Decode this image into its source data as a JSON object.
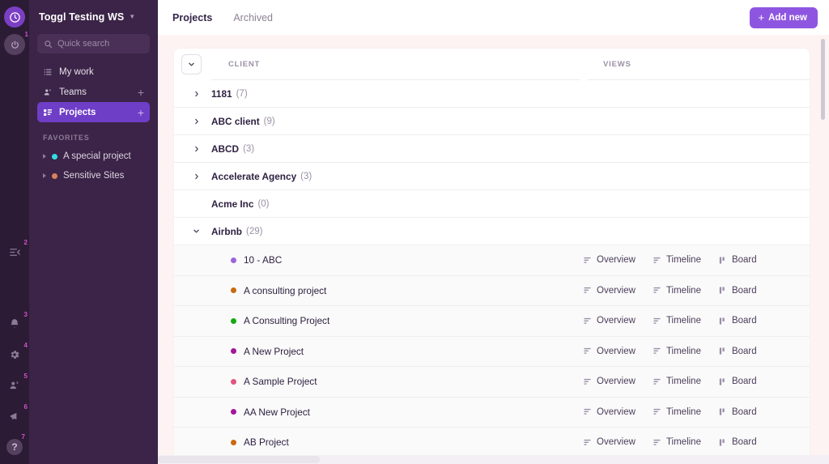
{
  "colors": {
    "rail_bg": "#2c1b35",
    "sidebar_bg": "#3b2447",
    "accent_purple": "#8e56e0",
    "active_nav": "#6f3ec7",
    "main_bg": "#fdf3f2",
    "card_bg": "#ffffff",
    "project_row_bg": "#fafafa",
    "badge_pink": "#d052c8"
  },
  "rail": {
    "logo_icon": "toggl-logo-icon",
    "timer_icon": "timer-power-icon",
    "timer_badge": "1",
    "items": [
      {
        "icon": "collapse-panel-icon",
        "badge": "2",
        "name": "collapse-sidebar-button"
      },
      {
        "icon": "bell-icon",
        "badge": "3",
        "name": "notifications-button"
      },
      {
        "icon": "gear-icon",
        "badge": "4",
        "name": "settings-button"
      },
      {
        "icon": "people-icon",
        "badge": "5",
        "name": "invite-team-button"
      },
      {
        "icon": "megaphone-icon",
        "badge": "6",
        "name": "whats-new-button"
      },
      {
        "icon": "question-mark-icon",
        "badge": "7",
        "name": "help-button"
      }
    ]
  },
  "sidebar": {
    "workspace_name": "Toggl Testing WS",
    "workspace_caret_icon": "chevron-down-icon",
    "search": {
      "placeholder": "Quick search",
      "icon": "search-icon"
    },
    "nav": [
      {
        "label": "My work",
        "icon": "list-icon",
        "active": false,
        "has_plus": false
      },
      {
        "label": "Teams",
        "icon": "team-icon",
        "active": false,
        "has_plus": true
      },
      {
        "label": "Projects",
        "icon": "projects-icon",
        "active": true,
        "has_plus": true
      }
    ],
    "plus_label": "+",
    "favorites_title": "FAVORITES",
    "favorites": [
      {
        "label": "A special project",
        "dot": "#2ee0e0"
      },
      {
        "label": "Sensitive Sites",
        "dot": "#d9825a"
      }
    ]
  },
  "topbar": {
    "tabs": [
      {
        "label": "Projects",
        "active": true
      },
      {
        "label": "Archived",
        "active": false
      }
    ],
    "add_new_label": "Add new",
    "add_new_icon": "plus-icon"
  },
  "table": {
    "collapse_all_icon": "chevron-down-icon",
    "columns": {
      "client": "CLIENT",
      "views": "VIEWS"
    },
    "view_actions": [
      {
        "label": "Overview",
        "icon": "overview-icon"
      },
      {
        "label": "Timeline",
        "icon": "timeline-icon"
      },
      {
        "label": "Board",
        "icon": "board-icon"
      }
    ],
    "clients": [
      {
        "name": "1181",
        "count": "(7)",
        "expanded": false,
        "has_chevron": true
      },
      {
        "name": "ABC client",
        "count": "(9)",
        "expanded": false,
        "has_chevron": true
      },
      {
        "name": "ABCD",
        "count": "(3)",
        "expanded": false,
        "has_chevron": true
      },
      {
        "name": "Accelerate Agency",
        "count": "(3)",
        "expanded": false,
        "has_chevron": true
      },
      {
        "name": "Acme Inc",
        "count": "(0)",
        "expanded": false,
        "has_chevron": false
      },
      {
        "name": "Airbnb",
        "count": "(29)",
        "expanded": true,
        "has_chevron": true
      }
    ],
    "projects": [
      {
        "name": "10 - ABC",
        "dot": "#9e62dd"
      },
      {
        "name": "A consulting project",
        "dot": "#c96a10"
      },
      {
        "name": "A Consulting Project",
        "dot": "#16a810"
      },
      {
        "name": "A New Project",
        "dot": "#a3169b"
      },
      {
        "name": "A Sample Project",
        "dot": "#e0557e"
      },
      {
        "name": "AA New Project",
        "dot": "#a3169b"
      },
      {
        "name": "AB Project",
        "dot": "#c96a10"
      }
    ]
  }
}
